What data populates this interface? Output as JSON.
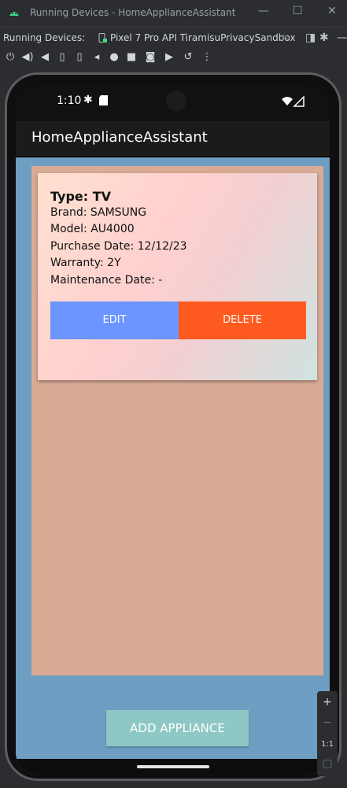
{
  "window": {
    "title": "Running Devices - HomeApplianceAssistant",
    "controls": [
      "—",
      "☐",
      "✕"
    ]
  },
  "tabbar": {
    "label": "Running Devices:",
    "tab_title": "Pixel 7 Pro API TiramisuPrivacySandbox",
    "tab_close": "×"
  },
  "toolbar": {
    "icons": [
      "power-icon",
      "volume-up-icon",
      "volume-down-icon",
      "rotate-left-icon",
      "rotate-right-icon",
      "back-icon",
      "home-icon",
      "overview-icon",
      "screenshot-icon",
      "screenrecord-icon",
      "reset-icon",
      "more-icon"
    ]
  },
  "device": {
    "status_time": "1:10",
    "app_title": "HomeApplianceAssistant"
  },
  "appliance": {
    "type": "Type: TV",
    "brand": "Brand: SAMSUNG",
    "model": "Model: AU4000",
    "purchase_date": "Purchase Date: 12/12/23",
    "warranty": "Warranty: 2Y",
    "maintenance_date": "Maintenance Date: -",
    "edit_label": "EDIT",
    "delete_label": "DELETE"
  },
  "actions": {
    "add_label": "ADD APPLIANCE"
  },
  "zoom": {
    "plus": "+",
    "minus": "−",
    "one_to_one": "1:1"
  },
  "colors": {
    "accent_tab": "#4b7bd8",
    "app_background": "#6e9fc3",
    "list_background": "#d9ab95",
    "edit_button": "#6b95ff",
    "delete_button": "#ff5a1f",
    "add_button": "#8ec8c4"
  }
}
